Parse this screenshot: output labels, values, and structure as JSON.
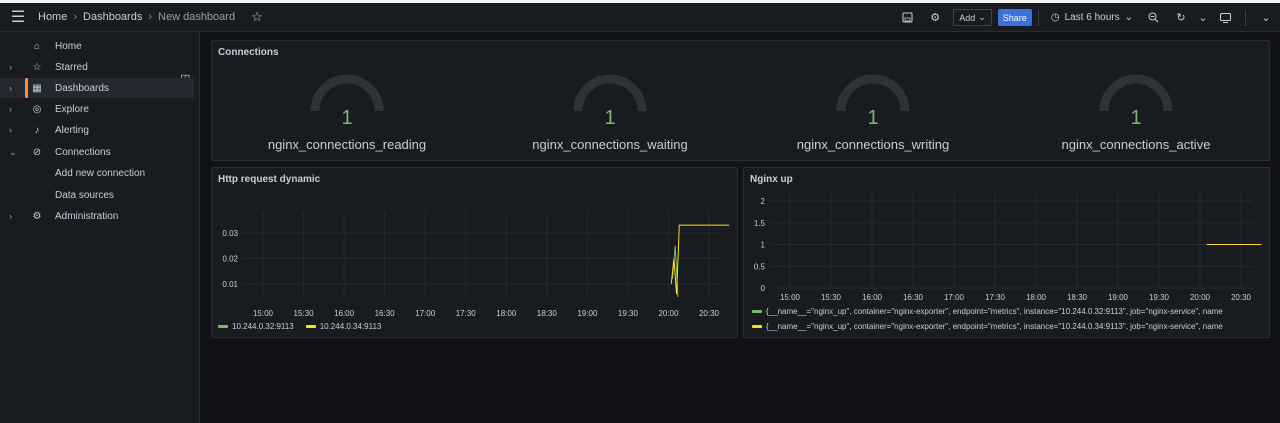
{
  "topbar": {
    "breadcrumbs": [
      "Home",
      "Dashboards",
      "New dashboard"
    ],
    "add_label": "Add",
    "share_label": "Share",
    "time_range": "Last 6 hours"
  },
  "sidebar": {
    "items": [
      {
        "label": "Home",
        "icon": "home-icon",
        "has_chevron": false
      },
      {
        "label": "Starred",
        "icon": "star-icon",
        "has_chevron": true
      },
      {
        "label": "Dashboards",
        "icon": "dashboards-icon",
        "has_chevron": true,
        "active": true
      },
      {
        "label": "Explore",
        "icon": "compass-icon",
        "has_chevron": true
      },
      {
        "label": "Alerting",
        "icon": "bell-icon",
        "has_chevron": true
      },
      {
        "label": "Connections",
        "icon": "connections-icon",
        "has_chevron": true,
        "expanded": true
      },
      {
        "label": "Administration",
        "icon": "gear-icon",
        "has_chevron": true
      }
    ],
    "sub_items": [
      "Add new connection",
      "Data sources"
    ]
  },
  "panels": {
    "connections": {
      "title": "Connections",
      "gauges": [
        {
          "value": "1",
          "name": "nginx_connections_reading"
        },
        {
          "value": "1",
          "name": "nginx_connections_waiting"
        },
        {
          "value": "1",
          "name": "nginx_connections_writing"
        },
        {
          "value": "1",
          "name": "nginx_connections_active"
        }
      ],
      "value_color": "#73bf69"
    },
    "http": {
      "title": "Http request dynamic",
      "legend": [
        {
          "label": "10.244.0.32:9113",
          "color": "#73bf69"
        },
        {
          "label": "10.244.0.34:9113",
          "color": "#fade2a"
        }
      ]
    },
    "nginx_up": {
      "title": "Nginx up",
      "legend": [
        {
          "label": "{__name__=\"nginx_up\", container=\"nginx-exporter\", endpoint=\"metrics\", instance=\"10.244.0.32:9113\", job=\"nginx-service\", name",
          "color": "#73bf69"
        },
        {
          "label": "{__name__=\"nginx_up\", container=\"nginx-exporter\", endpoint=\"metrics\", instance=\"10.244.0.34:9113\", job=\"nginx-service\", name",
          "color": "#fade2a"
        }
      ]
    }
  },
  "chart_data": [
    {
      "type": "line",
      "title": "Http request dynamic",
      "x": [
        "15:00",
        "15:30",
        "16:00",
        "16:30",
        "17:00",
        "17:30",
        "18:00",
        "18:30",
        "19:00",
        "19:30",
        "20:00",
        "20:30"
      ],
      "y_ticks": [
        "0.01",
        "0.02",
        "0.03"
      ],
      "ylim": [
        0.005,
        0.035
      ],
      "series": [
        {
          "name": "10.244.0.32:9113",
          "color": "#73bf69",
          "points": [
            [
              "20:03",
              0.012
            ],
            [
              "20:05",
              0.025
            ],
            [
              "20:07",
              0.005
            ]
          ]
        },
        {
          "name": "10.244.0.34:9113",
          "color": "#fade2a",
          "points": [
            [
              "20:02",
              0.01
            ],
            [
              "20:04",
              0.02
            ],
            [
              "20:06",
              0.006
            ],
            [
              "20:08",
              0.033
            ],
            [
              "20:45",
              0.033
            ]
          ]
        }
      ],
      "grid": true
    },
    {
      "type": "line",
      "title": "Nginx up",
      "x": [
        "15:00",
        "15:30",
        "16:00",
        "16:30",
        "17:00",
        "17:30",
        "18:00",
        "18:30",
        "19:00",
        "19:30",
        "20:00",
        "20:30"
      ],
      "y_ticks": [
        "0",
        "0.5",
        "1",
        "1.5",
        "2"
      ],
      "ylim": [
        0,
        2
      ],
      "series": [
        {
          "name": "{__name__=\"nginx_up\", container=\"nginx-exporter\", endpoint=\"metrics\", instance=\"10.244.0.32:9113\", job=\"nginx-service\", name",
          "color": "#73bf69",
          "points": [
            [
              "20:05",
              1
            ],
            [
              "20:45",
              1
            ]
          ]
        },
        {
          "name": "{__name__=\"nginx_up\", container=\"nginx-exporter\", endpoint=\"metrics\", instance=\"10.244.0.34:9113\", job=\"nginx-service\", name",
          "color": "#fade2a",
          "points": [
            [
              "20:05",
              1
            ],
            [
              "20:45",
              1
            ]
          ]
        }
      ],
      "grid": true
    }
  ]
}
